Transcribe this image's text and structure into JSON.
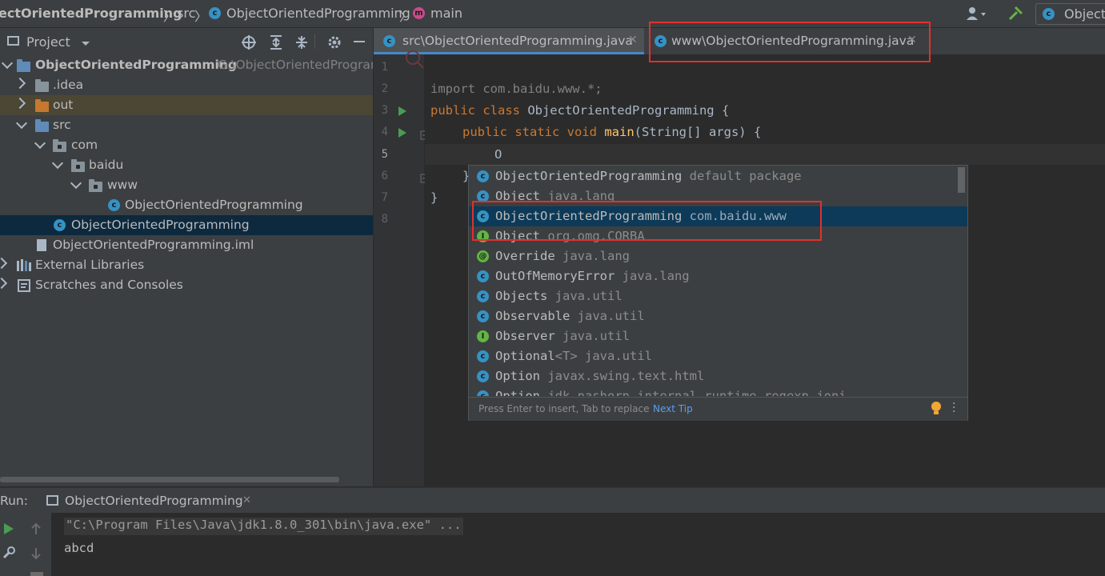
{
  "breadcrumb": {
    "project": "ectOrientedProgramming",
    "src": "src",
    "cls": "ObjectOrientedProgramming",
    "method": "main",
    "run_config": "Object"
  },
  "project_panel": {
    "title": "Project",
    "tree": [
      {
        "label": "ObjectOrientedProgramming",
        "path": "G:\\ObjectOrientedProgram"
      },
      {
        "label": ".idea"
      },
      {
        "label": "out"
      },
      {
        "label": "src"
      },
      {
        "label": "com"
      },
      {
        "label": "baidu"
      },
      {
        "label": "www"
      },
      {
        "label": "ObjectOrientedProgramming"
      },
      {
        "label": "ObjectOrientedProgramming"
      },
      {
        "label": "ObjectOrientedProgramming.iml"
      },
      {
        "label": "External Libraries"
      },
      {
        "label": "Scratches and Consoles"
      }
    ]
  },
  "editor": {
    "tabs": [
      {
        "label": "src\\ObjectOrientedProgramming.java"
      },
      {
        "label": "www\\ObjectOrientedProgramming.java"
      }
    ],
    "line_numbers": [
      "1",
      "2",
      "3",
      "4",
      "5",
      "6",
      "7",
      "8"
    ],
    "code": {
      "l2": "import com.baidu.www.*;",
      "l3_kw": "public class",
      "l3_rest": " ObjectOrientedProgramming {",
      "l4_kw": "public static void",
      "l4_fn": "main",
      "l4_rest": "(String[] args) {",
      "l5": "O",
      "l6": "}",
      "l7": "}"
    }
  },
  "completion": {
    "items": [
      {
        "icon": "c",
        "name": "ObjectOrientedProgramming",
        "pkg": "default package"
      },
      {
        "icon": "c",
        "name": "Object",
        "pkg": "java.lang"
      },
      {
        "icon": "c",
        "name": "ObjectOrientedProgramming",
        "pkg": "com.baidu.www"
      },
      {
        "icon": "i",
        "name": "Object",
        "pkg": "org.omg.CORBA"
      },
      {
        "icon": "@",
        "name": "Override",
        "pkg": "java.lang"
      },
      {
        "icon": "c",
        "name": "OutOfMemoryError",
        "pkg": "java.lang"
      },
      {
        "icon": "c",
        "name": "Objects",
        "pkg": "java.util"
      },
      {
        "icon": "c",
        "name": "Observable",
        "pkg": "java.util"
      },
      {
        "icon": "i",
        "name": "Observer",
        "pkg": "java.util"
      },
      {
        "icon": "c",
        "name": "Optional",
        "generic": "<T>",
        "pkg": "java.util"
      },
      {
        "icon": "c",
        "name": "Option",
        "pkg": "javax.swing.text.html"
      },
      {
        "icon": "c",
        "name": "Option",
        "pkg": "jdk.nashorn.internal.runtime.regexp.joni"
      }
    ],
    "selected_index": 2,
    "footer_hint": "Press Enter to insert, Tab to replace",
    "next_tip": "Next Tip"
  },
  "run": {
    "label": "Run:",
    "tab": "ObjectOrientedProgramming",
    "console_lines": [
      "\"C:\\Program Files\\Java\\jdk1.8.0_301\\bin\\java.exe\" ...",
      "abcd"
    ]
  },
  "colors": {
    "accent": "#4a88c7",
    "highlight_box": "#e0312d",
    "selection": "#0d3a58"
  }
}
